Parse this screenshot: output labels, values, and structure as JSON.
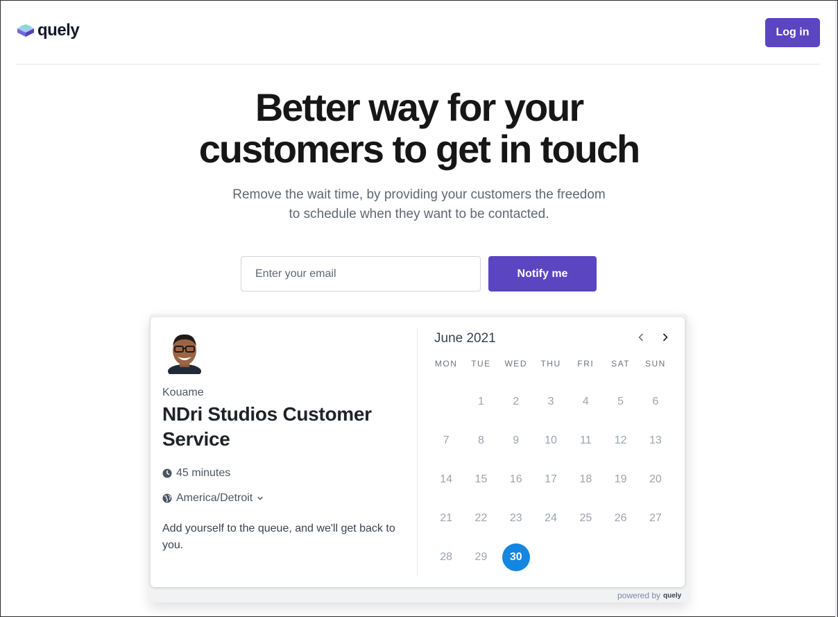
{
  "header": {
    "logo_text": "quely",
    "login_label": "Log in"
  },
  "hero": {
    "title_line1": "Better way for your",
    "title_line2": "customers to get in touch",
    "subtitle_line1": "Remove the wait time, by providing your customers the freedom",
    "subtitle_line2": "to schedule when they want to be contacted."
  },
  "signup": {
    "email_placeholder": "Enter your email",
    "email_value": "",
    "notify_label": "Notify me"
  },
  "widget": {
    "host_name": "Kouame",
    "event_title": "NDri Studios Customer Service",
    "duration": "45 minutes",
    "timezone": "America/Detroit",
    "description": "Add yourself to the queue, and we'll get back to you.",
    "calendar": {
      "month_label": "June 2021",
      "weekdays": [
        "MON",
        "TUE",
        "WED",
        "THU",
        "FRI",
        "SAT",
        "SUN"
      ],
      "leading_blanks": 1,
      "days": [
        "1",
        "2",
        "3",
        "4",
        "5",
        "6",
        "7",
        "8",
        "9",
        "10",
        "11",
        "12",
        "13",
        "14",
        "15",
        "16",
        "17",
        "18",
        "19",
        "20",
        "21",
        "22",
        "23",
        "24",
        "25",
        "26",
        "27",
        "28",
        "29",
        "30"
      ],
      "selected_day": "30"
    },
    "powered_by": "powered by",
    "powered_logo": "quely"
  },
  "colors": {
    "brand": "#5b45c1",
    "selected_day": "#1486e0"
  },
  "icons": [
    "quely-logo-icon",
    "clock-icon",
    "globe-icon",
    "chevron-down-icon",
    "chevron-left-icon",
    "chevron-right-icon"
  ]
}
